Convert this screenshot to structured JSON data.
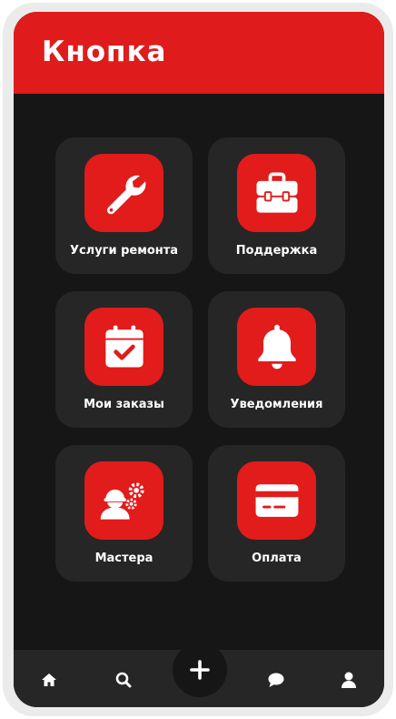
{
  "header": {
    "title": "Кнопка"
  },
  "tiles": [
    {
      "label": "Услуги ремонта",
      "icon": "wrench-icon"
    },
    {
      "label": "Поддержка",
      "icon": "toolbox-icon"
    },
    {
      "label": "Мои заказы",
      "icon": "calendar-check-icon"
    },
    {
      "label": "Уведомления",
      "icon": "bell-icon"
    },
    {
      "label": "Мастера",
      "icon": "worker-gears-icon"
    },
    {
      "label": "Оплата",
      "icon": "credit-card-icon"
    }
  ],
  "bottom_nav": [
    {
      "icon": "home-icon"
    },
    {
      "icon": "search-icon"
    },
    {
      "icon": "plus-icon"
    },
    {
      "icon": "chat-icon"
    },
    {
      "icon": "user-icon"
    }
  ],
  "colors": {
    "accent": "#e01b1b",
    "background": "#161616",
    "tile": "#262626",
    "frame": "#ebebeb"
  }
}
